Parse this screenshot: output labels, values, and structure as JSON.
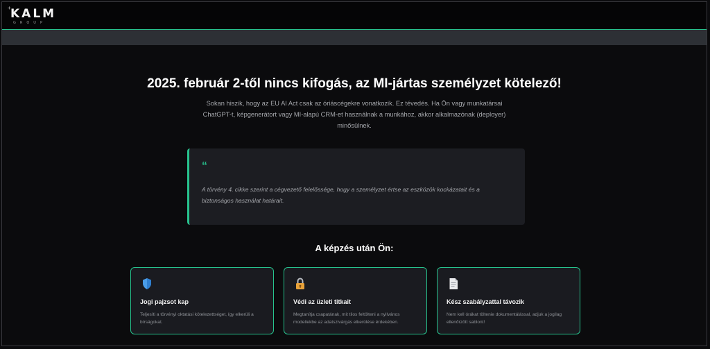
{
  "header": {
    "logo_main": "KALM",
    "logo_sub": "GROUP",
    "logo_plus": "+"
  },
  "hero": {
    "title": "2025. február 2-től nincs kifogás, az MI-jártas személyzet kötelező!",
    "description": "Sokan hiszik, hogy az EU AI Act csak az óriáscégekre vonatkozik. Ez tévedés. Ha Ön vagy munkatársai ChatGPT-t, képgenerátort vagy MI-alapú CRM-et használnak a munkához, akkor alkalmazónak (deployer) minősülnek."
  },
  "quote": {
    "mark": "“",
    "text": "A törvény 4. cikke szerint a cégvezető felelőssége, hogy a személyzet értse az eszközök kockázatait és a biztonságos használat határait."
  },
  "benefits": {
    "title": "A képzés után Ön:",
    "cards": [
      {
        "icon": "shield-icon",
        "title": "Jogi pajzsot kap",
        "desc": "Teljesíti a törvényi oktatási kötelezettséget, így elkerüli a bírságokat."
      },
      {
        "icon": "lock-icon",
        "title": "Védi az üzleti titkait",
        "desc": "Megtanítja csapatának, mit tilos feltölteni a nyilvános modellekbe az adatszivárgás elkerülése érdekében."
      },
      {
        "icon": "document-icon",
        "title": "Kész szabályzattal távozik",
        "desc": "Nem kell órákat töltenie dokumentálással, adjuk a jogilag ellenőrzött sablont!"
      }
    ]
  },
  "colors": {
    "accent": "#27c28d",
    "background": "#0b0b0d",
    "card": "#1a1b20",
    "shield": "#4a9de8",
    "lock": "#e8a23a"
  }
}
